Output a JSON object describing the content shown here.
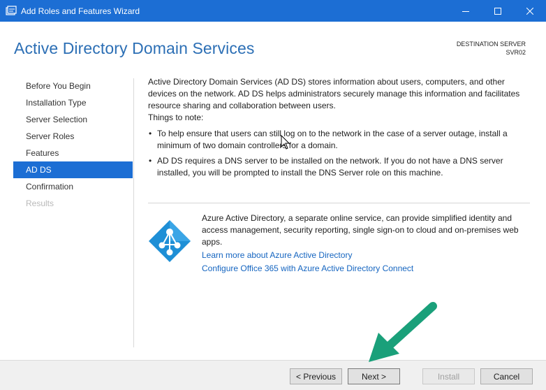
{
  "window": {
    "title": "Add Roles and Features Wizard",
    "controls": {
      "minimize": "minimize-icon",
      "maximize": "maximize-icon",
      "close": "close-icon"
    }
  },
  "header": {
    "title": "Active Directory Domain Services",
    "destination_label": "DESTINATION SERVER",
    "destination_server": "SVR02"
  },
  "nav": {
    "items": [
      {
        "label": "Before You Begin",
        "state": "normal"
      },
      {
        "label": "Installation Type",
        "state": "normal"
      },
      {
        "label": "Server Selection",
        "state": "normal"
      },
      {
        "label": "Server Roles",
        "state": "normal"
      },
      {
        "label": "Features",
        "state": "normal"
      },
      {
        "label": "AD DS",
        "state": "selected"
      },
      {
        "label": "Confirmation",
        "state": "normal"
      },
      {
        "label": "Results",
        "state": "disabled"
      }
    ]
  },
  "content": {
    "intro": "Active Directory Domain Services (AD DS) stores information about users, computers, and other devices on the network.  AD DS helps administrators securely manage this information and facilitates resource sharing and collaboration between users.",
    "notes_label": "Things to note:",
    "notes": [
      "To help ensure that users can still log on to the network in the case of a server outage, install a minimum of two domain controllers for a domain.",
      "AD DS requires a DNS server to be installed on the network.  If you do not have a DNS server installed, you will be prompted to install the DNS Server role on this machine."
    ],
    "azure": {
      "description": "Azure Active Directory, a separate online service, can provide simplified identity and access management, security reporting, single sign-on to cloud and on-premises web apps.",
      "link_learn": "Learn more about Azure Active Directory",
      "link_configure": "Configure Office 365 with Azure Active Directory Connect"
    }
  },
  "buttons": {
    "previous": "< Previous",
    "next": "Next >",
    "install": "Install",
    "cancel": "Cancel"
  },
  "colors": {
    "accent": "#1c6ed4",
    "title_text": "#2c6fb5",
    "link": "#1565c0",
    "annotation_arrow": "#1aa07a"
  }
}
